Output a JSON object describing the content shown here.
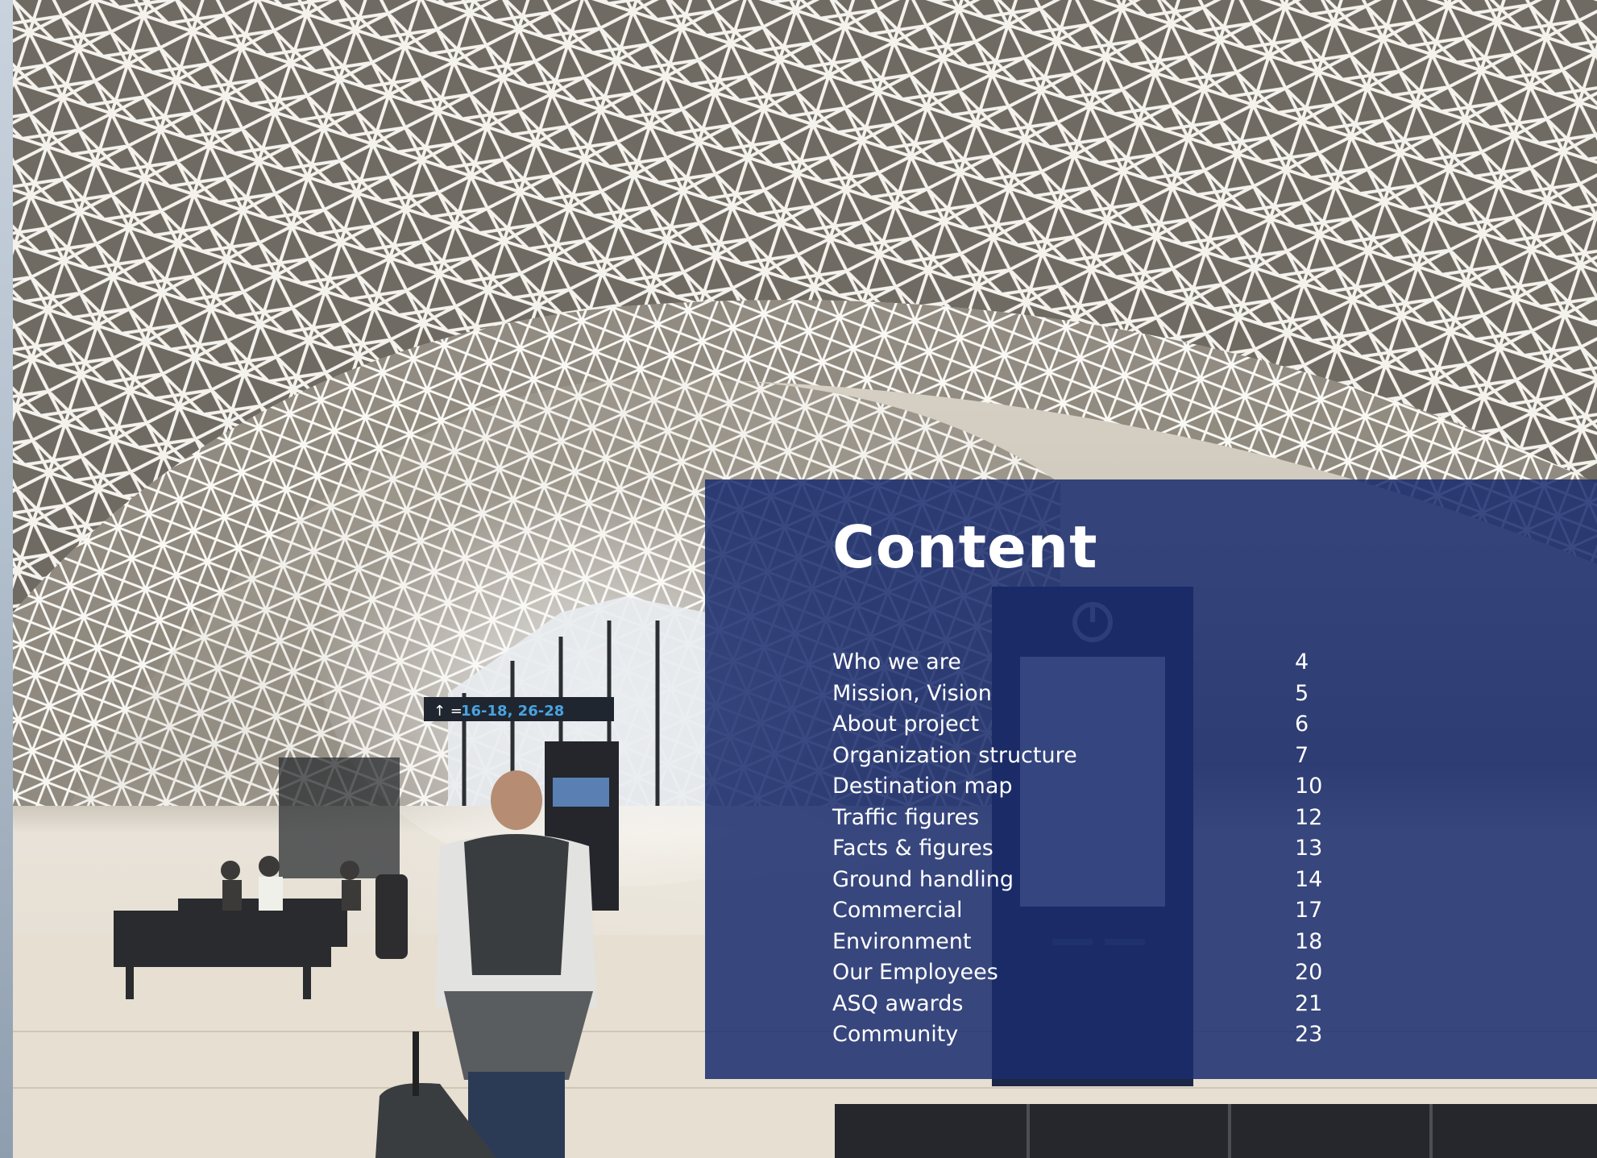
{
  "content": {
    "title": "Content",
    "items": [
      {
        "label": "Who we are",
        "page": "4"
      },
      {
        "label": "Mission, Vision",
        "page": "5"
      },
      {
        "label": "About project",
        "page": "6"
      },
      {
        "label": "Organization structure",
        "page": "7"
      },
      {
        "label": "Destination map",
        "page": "10"
      },
      {
        "label": "Traffic figures",
        "page": "12"
      },
      {
        "label": "Facts & figures",
        "page": "13"
      },
      {
        "label": "Ground handling",
        "page": "14"
      },
      {
        "label": "Commercial",
        "page": "17"
      },
      {
        "label": "Environment",
        "page": "18"
      },
      {
        "label": "Our Employees",
        "page": "20"
      },
      {
        "label": "ASQ awards",
        "page": "21"
      },
      {
        "label": "Community",
        "page": "23"
      }
    ]
  },
  "background": {
    "signage_text": "16-18, 26-28"
  },
  "colors": {
    "panel": "#1a2c6e",
    "text": "#ffffff"
  }
}
